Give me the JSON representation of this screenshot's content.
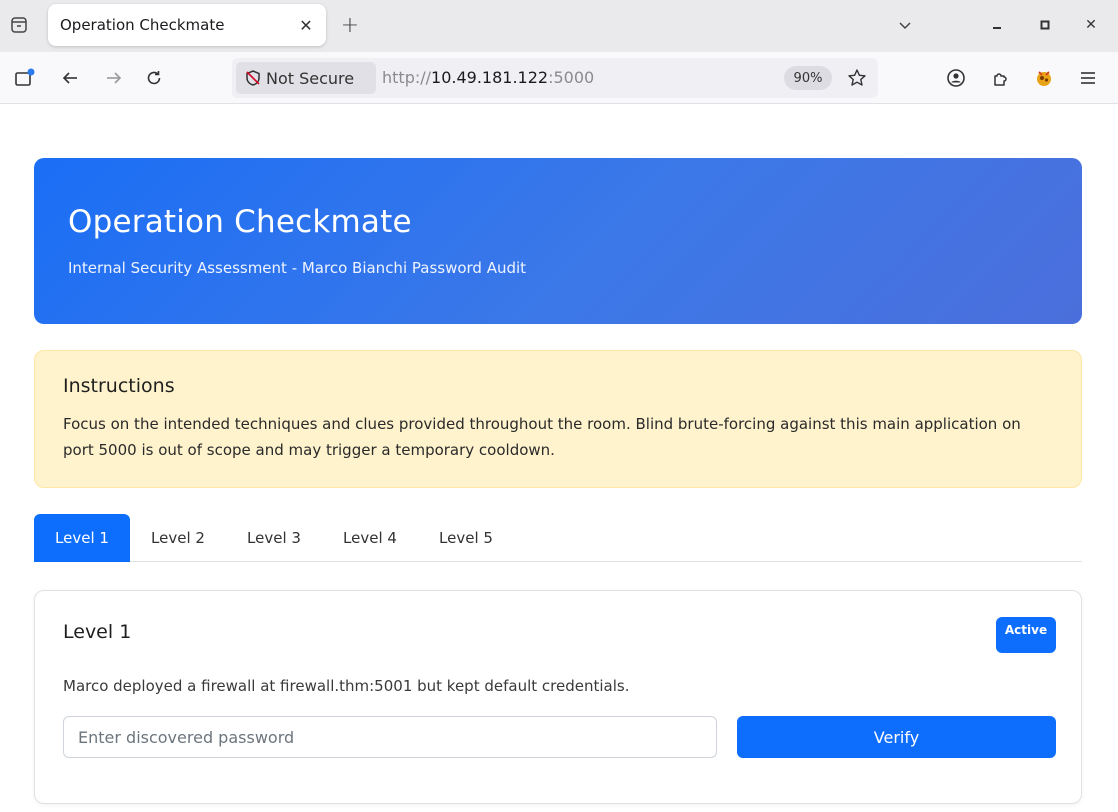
{
  "browser": {
    "tab_title": "Operation Checkmate",
    "not_secure_label": "Not Secure",
    "url_scheme": "http://",
    "url_host": "10.49.181.122",
    "url_port": ":5000",
    "zoom": "90%"
  },
  "page": {
    "hero": {
      "title": "Operation Checkmate",
      "subtitle": "Internal Security Assessment - Marco Bianchi Password Audit"
    },
    "instructions": {
      "heading": "Instructions",
      "body": "Focus on the intended techniques and clues provided throughout the room. Blind brute-forcing against this main application on port 5000 is out of scope and may trigger a temporary cooldown."
    },
    "tabs": [
      {
        "label": "Level 1",
        "active": true
      },
      {
        "label": "Level 2",
        "active": false
      },
      {
        "label": "Level 3",
        "active": false
      },
      {
        "label": "Level 4",
        "active": false
      },
      {
        "label": "Level 5",
        "active": false
      }
    ],
    "level_card": {
      "title": "Level 1",
      "badge": "Active",
      "description": "Marco deployed a firewall at firewall.thm:5001 but kept default credentials.",
      "input_placeholder": "Enter discovered password",
      "button_label": "Verify"
    }
  },
  "colors": {
    "primary": "#0d6efd",
    "hero_gradient_start": "#1b6ef5",
    "hero_gradient_end": "#4b6fdc",
    "alert_bg": "#fff3cd"
  }
}
